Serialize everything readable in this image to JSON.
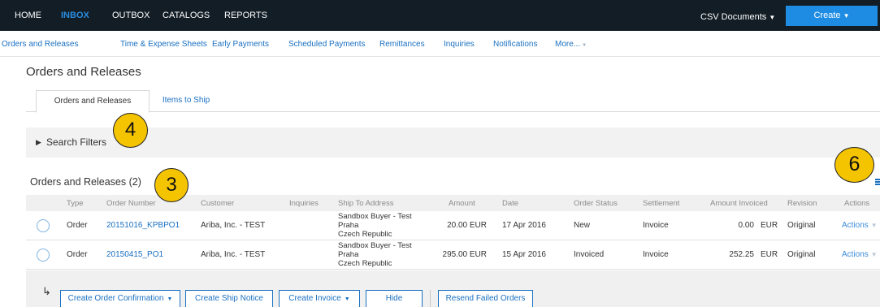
{
  "topnav": {
    "items": [
      "HOME",
      "INBOX",
      "OUTBOX",
      "CATALOGS",
      "REPORTS"
    ],
    "csv_documents": "CSV Documents",
    "create": "Create"
  },
  "subnav": {
    "items": [
      "Orders and Releases",
      "Time & Expense Sheets",
      "Early Payments",
      "Scheduled Payments",
      "Remittances",
      "Inquiries",
      "Notifications",
      "More..."
    ]
  },
  "page_title": "Orders and Releases",
  "tabs": [
    "Orders and Releases",
    "Items to Ship"
  ],
  "search_filters": "Search Filters",
  "section_title": "Orders and Releases (2)",
  "table": {
    "headers": [
      "Type",
      "Order Number",
      "Customer",
      "Inquiries",
      "Ship To Address",
      "Amount",
      "Date",
      "Order Status",
      "Settlement",
      "Amount Invoiced",
      "Revision",
      "Actions"
    ],
    "rows": [
      {
        "type": "Order",
        "order_number": "20151016_KPBPO1",
        "customer": "Ariba, Inc. - TEST",
        "address": [
          "Sandbox Buyer - Test",
          "Praha",
          "Czech Republic"
        ],
        "amount": "20.00 EUR",
        "date": "17 Apr 2016",
        "status": "New",
        "settlement": "Invoice",
        "amount_invoiced": "0.00",
        "invoiced_currency": "EUR",
        "revision": "Original",
        "actions": "Actions"
      },
      {
        "type": "Order",
        "order_number": "20150415_PO1",
        "customer": "Ariba, Inc. - TEST",
        "address": [
          "Sandbox Buyer - Test",
          "Praha",
          "Czech Republic"
        ],
        "amount": "295.00 EUR",
        "date": "15 Apr 2016",
        "status": "Invoiced",
        "settlement": "Invoice",
        "amount_invoiced": "252.25",
        "invoiced_currency": "EUR",
        "revision": "Original",
        "actions": "Actions"
      }
    ]
  },
  "action_buttons": [
    "Create Order Confirmation",
    "Create Ship Notice",
    "Create Invoice",
    "Hide",
    "Resend Failed Orders"
  ],
  "callouts": [
    "4",
    "3",
    "6"
  ],
  "icons": {
    "arrow": "return-arrow-icon",
    "menu": "list-menu-icon",
    "caret": "caret-down-icon"
  },
  "colors": {
    "nav_bg": "#121d26",
    "accent": "#1f8ce3",
    "link": "#1a70c1",
    "callout": "#f5c400"
  }
}
